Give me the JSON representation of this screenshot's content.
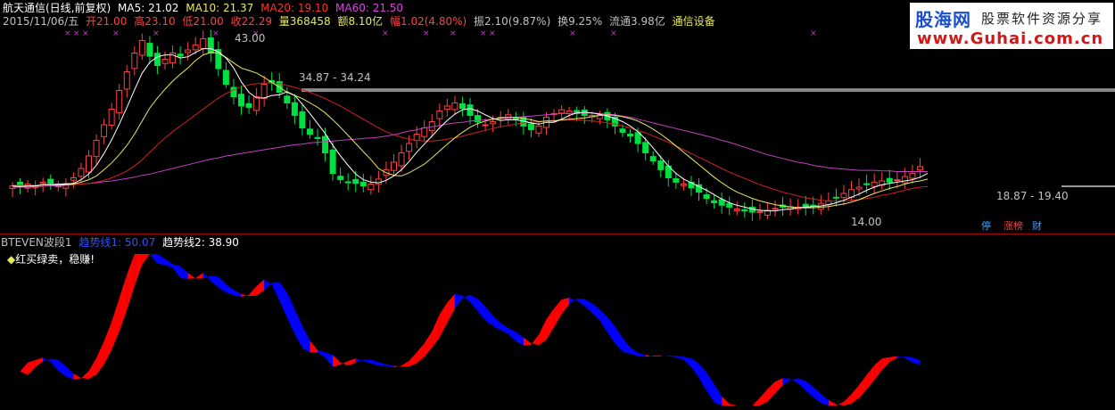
{
  "header": {
    "stock": "航天通信(日线,前复权)",
    "ma5": "MA5: 21.02",
    "ma10": "MA10: 21.37",
    "ma20": "MA20: 19.10",
    "ma60": "MA60: 21.50",
    "date": "2015/11/06/五",
    "open": "开21.00",
    "high": "高23.10",
    "low": "低21.00",
    "close": "收22.29",
    "volume": "量368458",
    "amount": "额8.10亿",
    "change": "幅1.02(4.80%)",
    "amplitude": "振2.10(9.87%)",
    "turnover": "换9.25%",
    "float": "流通3.98亿",
    "sector": "通信设备"
  },
  "annotations": {
    "high_price": "43.00",
    "resistance": "34.87 - 34.24",
    "support": "18.87 - 19.40",
    "low_price": "14.00"
  },
  "buttons": {
    "stop": "停",
    "limit": "涨榜",
    "finance": "财"
  },
  "lower": {
    "title": "BTEVEN波段1",
    "trend1": "趋势线1: 50.07",
    "trend2": "趋势线2: 38.90",
    "legend": "红买绿卖，稳赚!"
  },
  "logo": {
    "brand": "股海网",
    "slogan": "股票软件资源分享",
    "url": "www.Guhai.com.cn"
  },
  "colors": {
    "up": "#ff4040",
    "down": "#00e040",
    "ma5": "#ffffff",
    "ma10": "#e8e860",
    "ma20": "#d02020",
    "ma60": "#c040c0",
    "buy_band": "#ff0000",
    "sell_band": "#0000ff"
  },
  "chart_data": {
    "type": "candlestick+indicator",
    "price_range": [
      14.0,
      43.0
    ],
    "resistance_band": [
      34.24,
      34.87
    ],
    "support_band": [
      18.87,
      19.4
    ],
    "close": [
      19.2,
      19.0,
      19.5,
      19.3,
      19.8,
      19.6,
      19.2,
      19.6,
      20.5,
      22.0,
      24.0,
      26.5,
      29.0,
      31.5,
      34.5,
      37.5,
      40.5,
      42.5,
      40.0,
      38.5,
      39.5,
      40.5,
      40.0,
      41.0,
      41.8,
      42.8,
      40.5,
      38.0,
      35.5,
      33.5,
      32.0,
      31.8,
      33.5,
      35.5,
      35.8,
      34.2,
      32.5,
      30.5,
      28.5,
      27.5,
      26.8,
      24.5,
      21.2,
      20.2,
      19.7,
      19.6,
      19.2,
      19.5,
      20.3,
      21.8,
      23.0,
      24.5,
      26.0,
      27.5,
      28.5,
      29.5,
      31.2,
      32.0,
      32.5,
      31.6,
      30.5,
      29.5,
      29.0,
      29.5,
      30.2,
      30.6,
      29.8,
      28.8,
      28.2,
      28.8,
      30.2,
      30.8,
      31.4,
      31.2,
      30.8,
      30.5,
      30.5,
      30.6,
      29.8,
      28.8,
      27.8,
      27.2,
      26.0,
      24.5,
      23.2,
      21.8,
      20.5,
      19.8,
      19.5,
      18.9,
      18.2,
      17.2,
      16.5,
      16.1,
      15.8,
      15.5,
      15.2,
      15.0,
      15.1,
      15.3,
      15.6,
      15.8,
      15.9,
      15.8,
      15.8,
      16.0,
      16.4,
      16.8,
      17.3,
      18.0,
      18.6,
      19.0,
      19.4,
      19.8,
      20.0,
      19.8,
      20.2,
      20.7,
      21.2,
      22.29
    ],
    "ma5": [
      19.2,
      19.1,
      19.2,
      19.2,
      19.4,
      19.4,
      19.5,
      19.5,
      19.6,
      20.2,
      21.1,
      22.5,
      24.4,
      26.6,
      29.1,
      31.8,
      34.6,
      37.3,
      39.0,
      39.9,
      40.2,
      40.2,
      39.7,
      39.9,
      40.6,
      41.2,
      41.2,
      40.7,
      39.7,
      38.1,
      35.9,
      34.2,
      33.3,
      33.3,
      33.7,
      33.8,
      34.3,
      33.7,
      32.3,
      30.8,
      29.2,
      27.6,
      25.7,
      24.0,
      22.5,
      21.1,
      20.2,
      19.8,
      19.7,
      20.1,
      20.8,
      21.8,
      23.1,
      24.6,
      25.9,
      27.2,
      28.5,
      29.7,
      30.7,
      31.4,
      31.6,
      31.2,
      30.6,
      30.0,
      29.7,
      29.8,
      29.8,
      29.6,
      29.3,
      29.1,
      29.4,
      29.4,
      29.9,
      30.5,
      30.9,
      31.0,
      30.9,
      30.7,
      30.4,
      30.0,
      29.5,
      28.8,
      27.9,
      26.7,
      25.3,
      23.8,
      22.4,
      21.2,
      20.3,
      19.7,
      19.1,
      18.5,
      17.8,
      17.1,
      16.5,
      16.1,
      15.8,
      15.5,
      15.3,
      15.2,
      15.2,
      15.4,
      15.5,
      15.7,
      15.8,
      15.9,
      16.0,
      16.2,
      16.5,
      16.9,
      17.4,
      17.9,
      18.5,
      19.0,
      19.4,
      19.6,
      19.8,
      20.0,
      20.2,
      20.6,
      21.2
    ],
    "ma10": [
      19.2,
      19.1,
      19.2,
      19.2,
      19.4,
      19.4,
      19.3,
      19.4,
      19.5,
      19.8,
      20.2,
      20.8,
      21.8,
      22.9,
      24.2,
      25.7,
      27.5,
      29.6,
      31.7,
      33.3,
      34.7,
      36.0,
      37.1,
      38.1,
      39.3,
      40.2,
      40.6,
      40.5,
      39.8,
      38.9,
      38.1,
      37.7,
      37.3,
      36.6,
      35.8,
      35.0,
      34.2,
      33.7,
      33.2,
      32.5,
      31.8,
      30.9,
      29.8,
      28.6,
      27.3,
      26.0,
      24.7,
      23.4,
      22.0,
      21.3,
      20.9,
      20.8,
      21.3,
      22.0,
      22.7,
      23.7,
      24.8,
      25.9,
      26.9,
      27.8,
      28.6,
      29.2,
      29.6,
      29.9,
      30.1,
      30.2,
      30.2,
      30.0,
      29.8,
      29.5,
      29.6,
      29.6,
      29.8,
      29.9,
      30.0,
      30.1,
      30.3,
      30.5,
      30.6,
      30.5,
      30.3,
      30.0,
      29.6,
      29.0,
      28.3,
      27.5,
      26.6,
      25.6,
      24.6,
      23.6,
      22.6,
      21.6,
      20.6,
      19.7,
      18.9,
      18.2,
      17.7,
      17.2,
      16.8,
      16.5,
      16.2,
      16.0,
      15.8,
      15.7,
      15.7,
      15.7,
      15.8,
      15.9,
      16.1,
      16.3,
      16.6,
      17.0,
      17.5,
      18.0,
      18.4,
      18.8,
      19.1,
      19.5,
      19.8,
      20.0,
      20.3
    ],
    "ma20": [
      19.3,
      19.3,
      19.3,
      19.3,
      19.3,
      19.4,
      19.4,
      19.4,
      19.4,
      19.5,
      19.6,
      19.8,
      20.1,
      20.5,
      21.0,
      21.6,
      22.4,
      23.4,
      24.6,
      25.8,
      26.9,
      27.9,
      28.8,
      29.7,
      30.6,
      31.5,
      32.4,
      33.3,
      34.0,
      34.6,
      35.1,
      35.4,
      35.6,
      35.7,
      35.7,
      35.6,
      35.3,
      35.0,
      34.6,
      34.2,
      33.7,
      33.2,
      32.6,
      32.0,
      31.3,
      30.6,
      29.9,
      29.2,
      28.5,
      27.9,
      27.4,
      27.0,
      26.7,
      26.5,
      26.4,
      26.4,
      26.5,
      26.7,
      26.9,
      27.2,
      27.5,
      27.8,
      28.1,
      28.4,
      28.7,
      28.9,
      29.1,
      29.3,
      29.4,
      29.5,
      29.6,
      29.7,
      29.7,
      29.8,
      29.8,
      29.7,
      29.6,
      29.5,
      29.3,
      29.1,
      28.8,
      28.5,
      28.1,
      27.7,
      27.2,
      26.7,
      26.2,
      25.6,
      25.0,
      24.4,
      23.8,
      23.2,
      22.6,
      22.0,
      21.4,
      20.9,
      20.4,
      19.9,
      19.4,
      19.0,
      18.6,
      18.2,
      17.9,
      17.6,
      17.3,
      17.1,
      16.9,
      16.8,
      16.8,
      16.8,
      16.9,
      17.0,
      17.2,
      17.4,
      17.7,
      17.9,
      18.2,
      18.5,
      18.8,
      19.0,
      19.1
    ],
    "ma60": [
      19.0,
      19.0,
      19.0,
      19.1,
      19.1,
      19.2,
      19.2,
      19.3,
      19.4,
      19.5,
      19.6,
      19.7,
      19.9,
      20.0,
      20.2,
      20.4,
      20.6,
      20.9,
      21.1,
      21.4,
      21.7,
      22.0,
      22.3,
      22.6,
      22.9,
      23.2,
      23.5,
      23.7,
      24.0,
      24.2,
      24.4,
      24.6,
      24.8,
      25.0,
      25.2,
      25.4,
      25.6,
      25.8,
      25.9,
      26.1,
      26.2,
      26.3,
      26.4,
      26.5,
      26.6,
      26.7,
      26.8,
      26.9,
      27.0,
      27.2,
      27.4,
      27.7,
      28.0,
      28.2,
      28.5,
      28.7,
      28.9,
      29.1,
      29.3,
      29.4,
      29.6,
      29.7,
      29.8,
      29.9,
      30.0,
      30.1,
      30.2,
      30.3,
      30.4,
      30.5,
      30.6,
      30.7,
      30.8,
      30.8,
      30.9,
      30.9,
      30.9,
      30.8,
      30.7,
      30.6,
      30.4,
      30.2,
      29.9,
      29.6,
      29.3,
      29.0,
      28.7,
      28.4,
      28.1,
      27.8,
      27.5,
      27.2,
      26.9,
      26.5,
      26.2,
      25.8,
      25.4,
      25.0,
      24.6,
      24.2,
      23.9,
      23.6,
      23.3,
      23.0,
      22.8,
      22.5,
      22.3,
      22.1,
      22.0,
      21.9,
      21.8,
      21.7,
      21.7,
      21.7,
      21.6,
      21.6,
      21.5,
      21.5,
      21.5,
      21.5,
      21.5
    ]
  }
}
